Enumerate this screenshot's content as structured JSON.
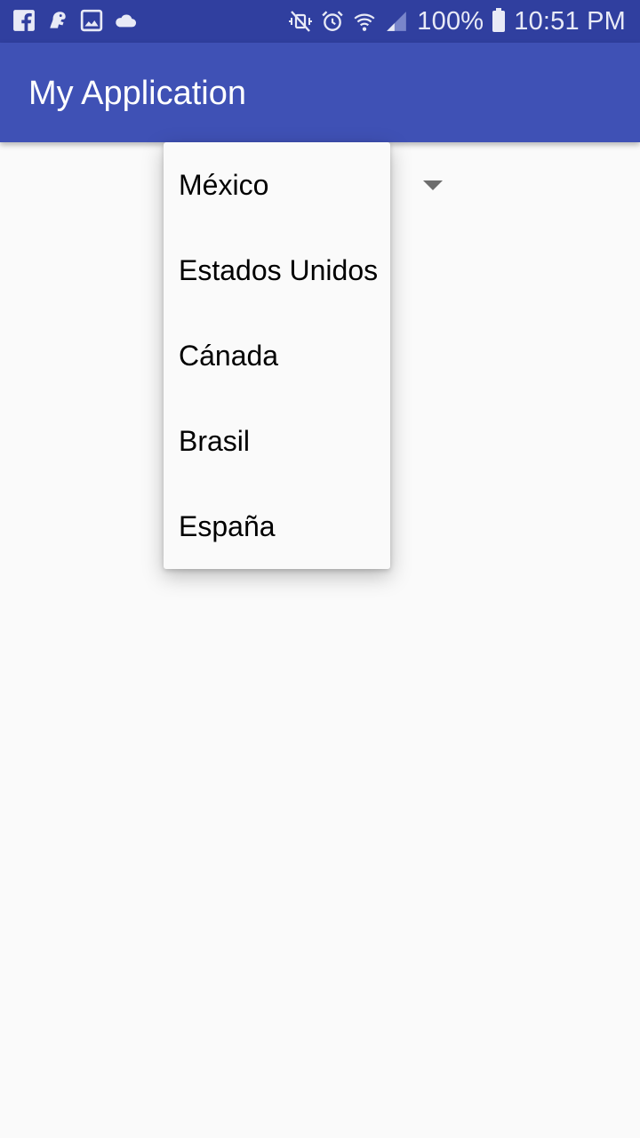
{
  "status_bar": {
    "left_icons": [
      "facebook-icon",
      "game-icon",
      "gallery-icon",
      "cloud-icon"
    ],
    "right_icons": [
      "mute-icon",
      "alarm-icon",
      "wifi-icon",
      "signal-icon",
      "battery-icon"
    ],
    "battery": "100%",
    "time": "10:51 PM"
  },
  "app_bar": {
    "title": "My Application"
  },
  "spinner": {
    "icon": "dropdown-arrow-icon",
    "options": [
      "México",
      "Estados Unidos",
      "Cánada",
      "Brasil",
      "España"
    ]
  },
  "colors": {
    "status_bar": "#303f9f",
    "primary": "#3f51b5",
    "background": "#fafafa"
  }
}
